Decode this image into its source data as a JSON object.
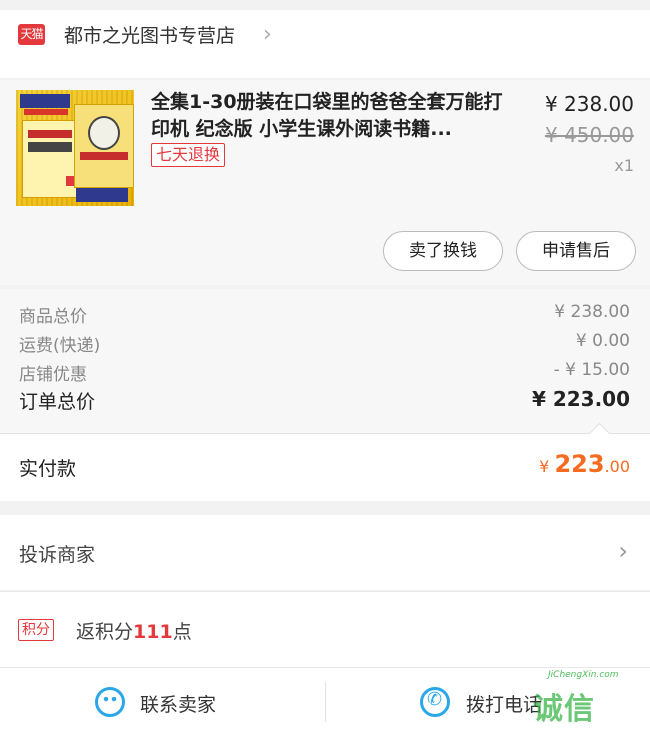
{
  "shop": {
    "badge": "天猫",
    "name": "都市之光图书专营店"
  },
  "product": {
    "title": "全集1-30册装在口袋里的爸爸全套万能打印机 纪念版 小学生课外阅读书籍...",
    "return_policy": "七天退换",
    "price_now": "¥ 238.00",
    "price_original": "¥ 450.00",
    "quantity": "x1",
    "actions": {
      "sell": "卖了换钱",
      "after_sale": "申请售后"
    }
  },
  "summary": {
    "goods_total_label": "商品总价",
    "goods_total_value": "¥ 238.00",
    "shipping_label": "运费(快递)",
    "shipping_value": "¥ 0.00",
    "discount_label": "店铺优惠",
    "discount_value": "- ¥ 15.00",
    "order_total_label": "订单总价",
    "order_total_value": "¥ 223.00"
  },
  "payment": {
    "label": "实付款",
    "currency": "¥",
    "amount_int": "223",
    "amount_dec": ".00"
  },
  "complaint": {
    "label": "投诉商家"
  },
  "points": {
    "badge": "积分",
    "prefix": "返积分",
    "amount": "111",
    "suffix": "点"
  },
  "bottom_bar": {
    "contact_label": "联系卖家",
    "call_label": "拨打电话"
  },
  "watermark": {
    "logo": "诚信",
    "text": "JiChengXin.com"
  },
  "colors": {
    "brand_red": "#e4393c",
    "pay_orange": "#f56b1f",
    "icon_blue": "#29a7e8"
  }
}
